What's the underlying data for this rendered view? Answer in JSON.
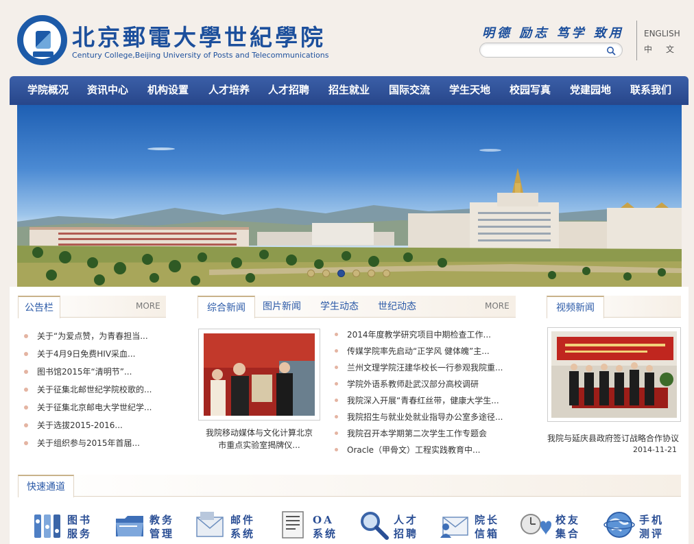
{
  "header": {
    "school_name_cn": "北京郵電大學世紀學院",
    "school_name_en": "Century College,Beijing University of Posts and Telecommunications",
    "motto": "明德 励志 笃学 致用",
    "search_placeholder": "",
    "lang_en": "ENGLISH",
    "lang_cn": "中文"
  },
  "nav": {
    "items": [
      "学院概况",
      "资讯中心",
      "机构设置",
      "人才培养",
      "人才招聘",
      "招生就业",
      "国际交流",
      "学生天地",
      "校园写真",
      "党建园地",
      "联系我们"
    ]
  },
  "banner": {
    "slide_count": 6,
    "active_slide": 3
  },
  "notice": {
    "title": "公告栏",
    "more": "MORE",
    "items": [
      "关于“为爱点赞，为青春担当...",
      "关于4月9日免费HIV采血...",
      "图书馆2015年“清明节”...",
      "关于征集北邮世纪学院校歌的...",
      "关于征集北京邮电大学世纪学...",
      "关于选拔2015-2016...",
      "关于组织参与2015年首届..."
    ]
  },
  "news": {
    "tabs": [
      "综合新闻",
      "图片新闻",
      "学生动态",
      "世纪动态"
    ],
    "more": "MORE",
    "photo_caption": "我院移动媒体与文化计算北京市重点实验室揭牌仪...",
    "items": [
      "2014年度教学研究项目中期检查工作...",
      "传媒学院率先启动“正学风 健体魄”主...",
      "兰州文理学院汪建华校长一行参观我院重...",
      "学院外语系教师赴武汉部分高校调研",
      "我院深入开展“青春红丝带，健康大学生...",
      "我院招生与就业处就业指导办公室多途径...",
      "我院召开本学期第二次学生工作专题会",
      "Oracle（甲骨文）工程实践教育中..."
    ]
  },
  "video": {
    "title": "视频新闻",
    "caption": "我院与延庆县政府签订战略合作协议",
    "date": "2014-11-21"
  },
  "quick": {
    "title": "快速通道",
    "items": [
      {
        "label": "图书服务",
        "icon": "library-icon"
      },
      {
        "label": "教务管理",
        "icon": "folder-icon"
      },
      {
        "label": "邮件系统",
        "icon": "mail-icon"
      },
      {
        "label": "OA系统",
        "icon": "document-icon"
      },
      {
        "label": "人才招聘",
        "icon": "magnifier-icon"
      },
      {
        "label": "院长信箱",
        "icon": "envelope-user-icon"
      },
      {
        "label": "校友集合",
        "icon": "heart-clock-icon"
      },
      {
        "label": "手机测评",
        "icon": "globe-icon"
      }
    ]
  },
  "colors": {
    "nav_blue": "#2f52a0",
    "link_blue": "#2a59a7",
    "page_bg": "#f4efea"
  }
}
